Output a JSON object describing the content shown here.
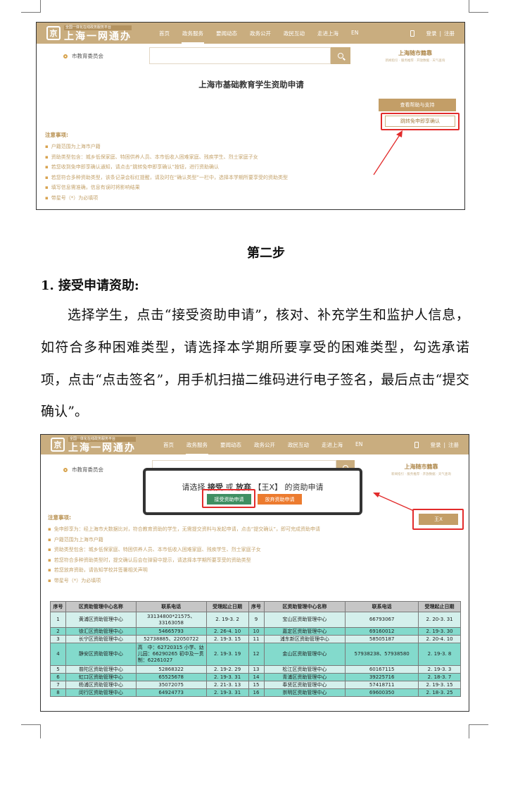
{
  "shot1": {
    "logo_small": "全国一体化在线政务服务平台",
    "logo_big": "上海一网通办",
    "logo_glyph": "京",
    "nav": [
      "首页",
      "政务服务",
      "要闻动态",
      "政务公开",
      "政民互动",
      "走进上海",
      "EN"
    ],
    "login": "登录",
    "register": "注册",
    "login_sep": "|",
    "org": "市教育委员会",
    "brand_title": "上海随市籍靠",
    "brand_sub": "新闻指引 · 服务推荐 · 开放数据 · 天气查询",
    "page_title": "上海市基础教育学生资助申请",
    "help_btn": "查看帮助与支持",
    "confirm_btn": "跳转免申即享确认",
    "notes_title": "注意事项:",
    "notes": [
      "户籍范围为上海市户籍",
      "资助类型包含：城乡低保家庭、特困供养人员、本市低收入困难家庭、残疾学生、烈士家庭子女",
      "若您收到免申即享确认通知，请点击“跳转免申即享确认”按钮，进行资助确认",
      "若您符合多种资助类型，该条记录会标红提醒，请及时在“确认类型”一栏中，选择本学期所要享受的资助类型",
      "填写信息需准确，信息有误时将影响结果",
      "带星号（*）为必填项"
    ]
  },
  "step_heading": "第二步",
  "sub_heading": "1. 接受申请资助:",
  "paragraph": "选择学生，点击“接受资助申请”，核对、补充学生和监护人信息，如符合多种困难类型，请选择本学期所要享受的困难类型，勾选承诺项，点击“点击签名”，用手机扫描二维码进行电子签名，最后点击“提交确认”。",
  "shot2": {
    "dialog_pre": "请选择",
    "dialog_accept_word": "接受",
    "dialog_or": "或",
    "dialog_reject_word": "放弃",
    "dialog_name": "【王X】",
    "dialog_post": "的资助申请",
    "accept_btn": "接受资助申请",
    "reject_btn": "放弃资助申请",
    "student_btn": "王X",
    "notes": [
      "免申即享为：经上海市大数据比对，符合教育资助的学生，无需提交资料与发起申请，点击“提交确认”，即可完成资助申请",
      "户籍范围为上海市户籍",
      "资助类型包含：城乡低保家庭、特困供养人员、本市低收入困难家庭、残疾学生、烈士家庭子女",
      "若您符合多种资助类型时，提交确认后会在弹窗中提示，请选择本学期所要享受的资助类型",
      "若您放弃资助，请告知学校并签署相关声明",
      "带星号（*）为必填项"
    ],
    "table_headers": [
      "序号",
      "区资助管理中心名称",
      "联系电话",
      "受理起止日期",
      "序号",
      "区资助管理中心名称",
      "联系电话",
      "受理起止日期"
    ],
    "rows": [
      [
        "1",
        "黄浦区资助管理中心",
        "33134800*21575、33163058",
        "2. 19-3. 2",
        "9",
        "宝山区资助管理中心",
        "66793067",
        "2. 20-3. 31"
      ],
      [
        "2",
        "徐汇区资助管理中心",
        "54665793",
        "2. 26-4. 10",
        "10",
        "嘉定区资助管理中心",
        "69160012",
        "2. 19-3. 30"
      ],
      [
        "3",
        "长宁区资助管理中心",
        "52738885、22050722",
        "2. 19-3. 15",
        "11",
        "浦东新区资助管理中心",
        "58505187",
        "2. 20-4. 10"
      ],
      [
        "4",
        "静安区资助管理中心",
        "高　中：62720315 小学、幼儿园：66290265 初中及一贯制：62261027",
        "2. 19-3. 19",
        "12",
        "金山区资助管理中心",
        "57938238、57938580",
        "2. 19-3. 8"
      ],
      [
        "5",
        "普陀区资助管理中心",
        "52868322",
        "2. 19-2. 29",
        "13",
        "松江区资助管理中心",
        "60167115",
        "2. 19-3. 3"
      ],
      [
        "6",
        "虹口区资助管理中心",
        "65525678",
        "2. 19-3. 31",
        "14",
        "青浦区资助管理中心",
        "39225716",
        "2. 18-3. 7"
      ],
      [
        "7",
        "杨浦区资助管理中心",
        "35072075",
        "2. 21-3. 13",
        "15",
        "奉贤区资助管理中心",
        "57418711",
        "2. 19-3. 15"
      ],
      [
        "8",
        "闵行区资助管理中心",
        "64924773",
        "2. 19-3. 31",
        "16",
        "崇明区资助管理中心",
        "69600350",
        "2. 18-3. 25"
      ]
    ]
  }
}
